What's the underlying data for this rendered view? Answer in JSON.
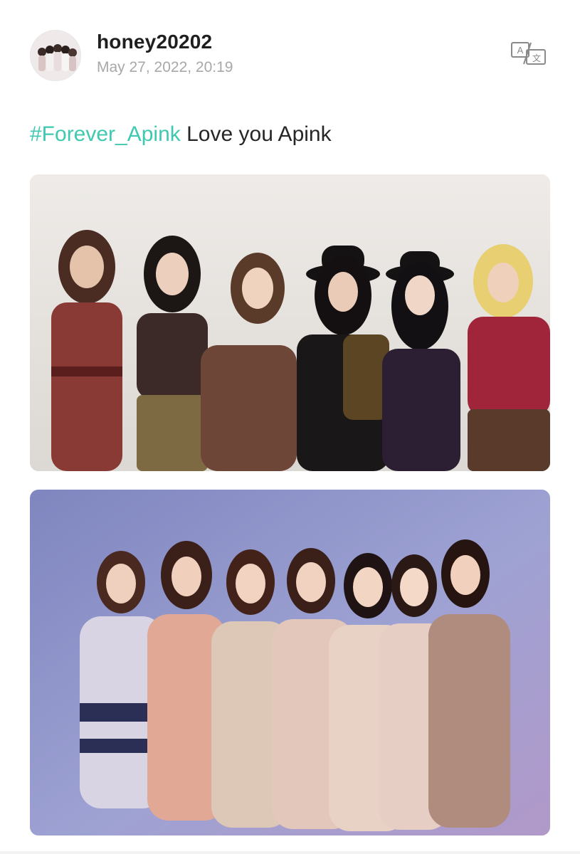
{
  "post": {
    "username": "honey20202",
    "timestamp": "May 27, 2022, 20:19",
    "hashtag": "#Forever_Apink",
    "caption": " Love you Apink",
    "translate_icon": "translate-icon"
  },
  "colors": {
    "hashtag": "#3fc9b0",
    "username": "#1f1f1f",
    "timestamp": "#a8a8a8",
    "text": "#262626"
  },
  "photos": [
    {
      "name": "group-photo-1",
      "people": 6,
      "backdrop": "white wall"
    },
    {
      "name": "group-photo-2",
      "people": 7,
      "backdrop": "lavender studio"
    }
  ]
}
